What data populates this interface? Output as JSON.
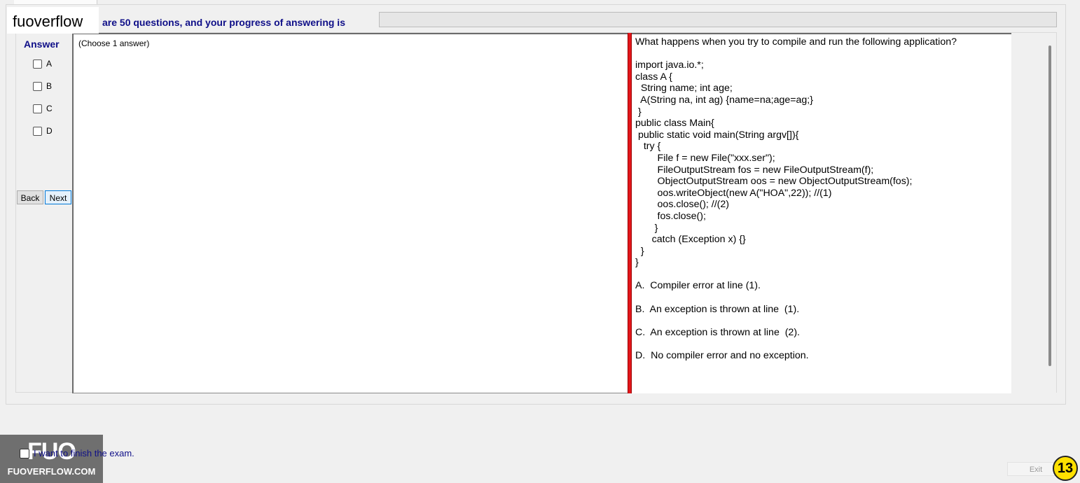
{
  "brand": "fuoverflow",
  "header": {
    "progress_label": "are 50 questions, and your progress of answering is",
    "progress_fraction": 0.0
  },
  "answer_panel": {
    "title": "Answer",
    "options": [
      "A",
      "B",
      "C",
      "D"
    ],
    "back_label": "Back",
    "next_label": "Next"
  },
  "choose_hint": "(Choose 1 answer)",
  "question": {
    "text": "What happens when you try to compile and run the following application?\n\nimport java.io.*;\nclass A {\n  String name; int age;\n  A(String na, int ag) {name=na;age=ag;}\n }\npublic class Main{\n public static void main(String argv[]){\n   try {\n        File f = new File(\"xxx.ser\");\n        FileOutputStream fos = new FileOutputStream(f);\n        ObjectOutputStream oos = new ObjectOutputStream(fos);\n        oos.writeObject(new A(\"HOA\",22)); //(1)\n        oos.close(); //(2)\n        fos.close();\n       }\n      catch (Exception x) {}\n  }\n}\n\nA.  Compiler error at line (1).\n\nB.  An exception is thrown at line  (1).\n\nC.  An exception is thrown at line  (2).\n\nD.  No compiler error and no exception."
  },
  "footer": {
    "finish_label": "I want to finish the exam.",
    "exit_label": "Exit",
    "page_number": "13"
  },
  "watermark": {
    "mark": "FUO",
    "text": "FUOVERFLOW.COM"
  },
  "colors": {
    "label_blue": "#0f0f88",
    "splitter_red": "#e3161b",
    "badge_yellow": "#ffe000"
  }
}
